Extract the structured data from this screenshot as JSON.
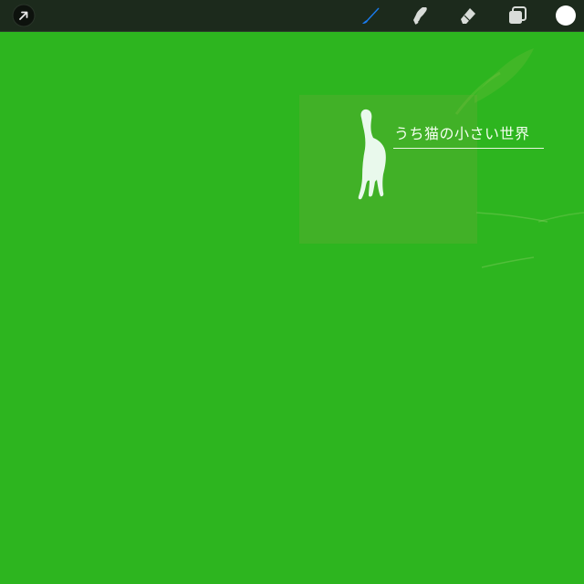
{
  "toolbar": {
    "tools": [
      {
        "name": "modify-arrow",
        "icon": "arrow-icon"
      },
      {
        "name": "brush",
        "icon": "brush-icon",
        "active": true
      },
      {
        "name": "smudge",
        "icon": "smudge-icon"
      },
      {
        "name": "eraser",
        "icon": "eraser-icon"
      },
      {
        "name": "layers",
        "icon": "layers-icon"
      },
      {
        "name": "color",
        "icon": "color-swatch",
        "color": "#ffffff"
      }
    ],
    "active_color": "#1a7cf0"
  },
  "canvas": {
    "background_color": "#2db51f",
    "title": "うち猫の小さい世界"
  }
}
